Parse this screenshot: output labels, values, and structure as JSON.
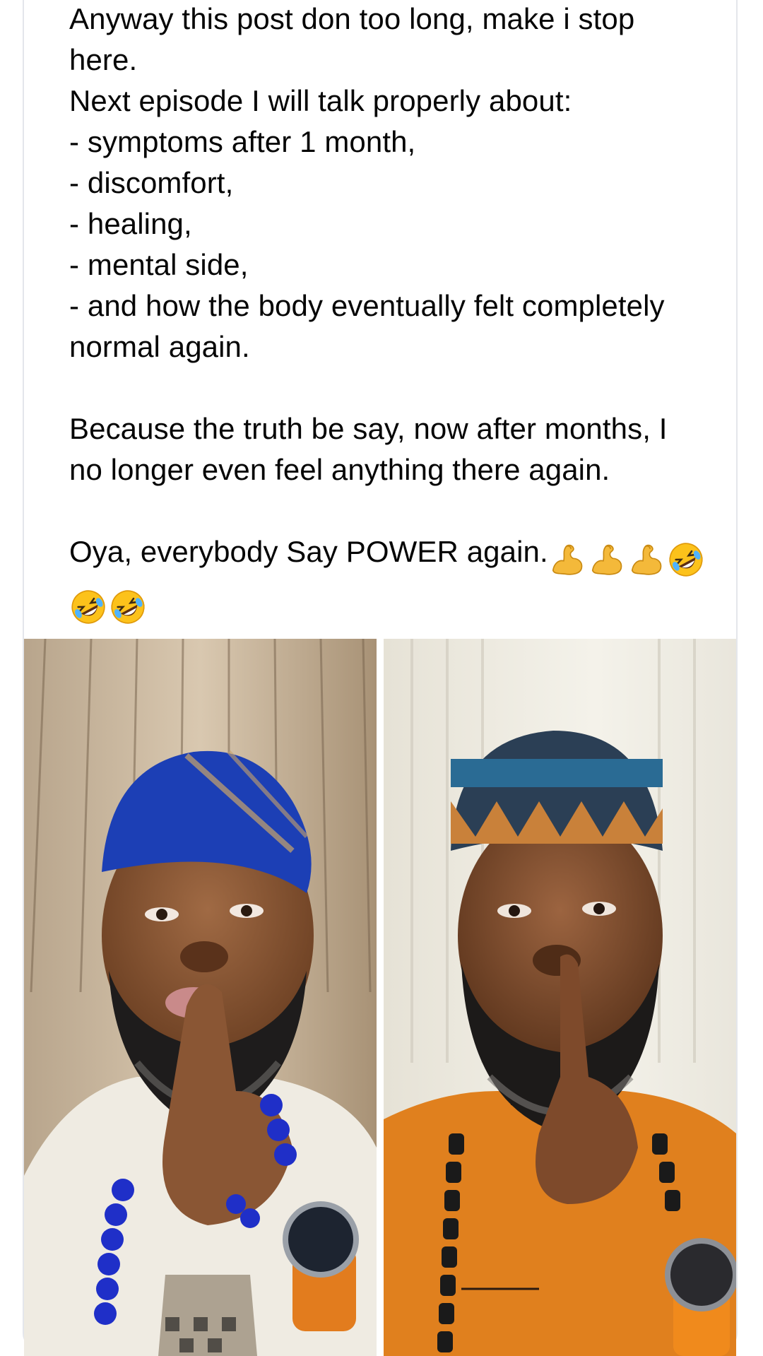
{
  "post": {
    "lines": [
      "Anyway this post don too long, make i stop",
      "here.",
      "Next episode I will talk properly about:",
      "- symptoms after 1 month,",
      "- discomfort,",
      "- healing,",
      "- mental side,",
      "- and how the body eventually felt completely",
      "normal again.",
      "Because the truth be say, now after months, I",
      "no longer even feel anything there again.",
      "Oya, everybody Say POWER again."
    ],
    "emojis": [
      "flexed-biceps",
      "flexed-biceps",
      "flexed-biceps",
      "rolling-on-floor-laughing",
      "rolling-on-floor-laughing",
      "rolling-on-floor-laughing"
    ]
  },
  "photos": [
    {
      "name": "photo-left",
      "cap_color": "#1c3fb5",
      "outfit_color": "#eeeae0"
    },
    {
      "name": "photo-right",
      "cap_color": "#2a6b94",
      "outfit_color": "#e0801e"
    }
  ]
}
